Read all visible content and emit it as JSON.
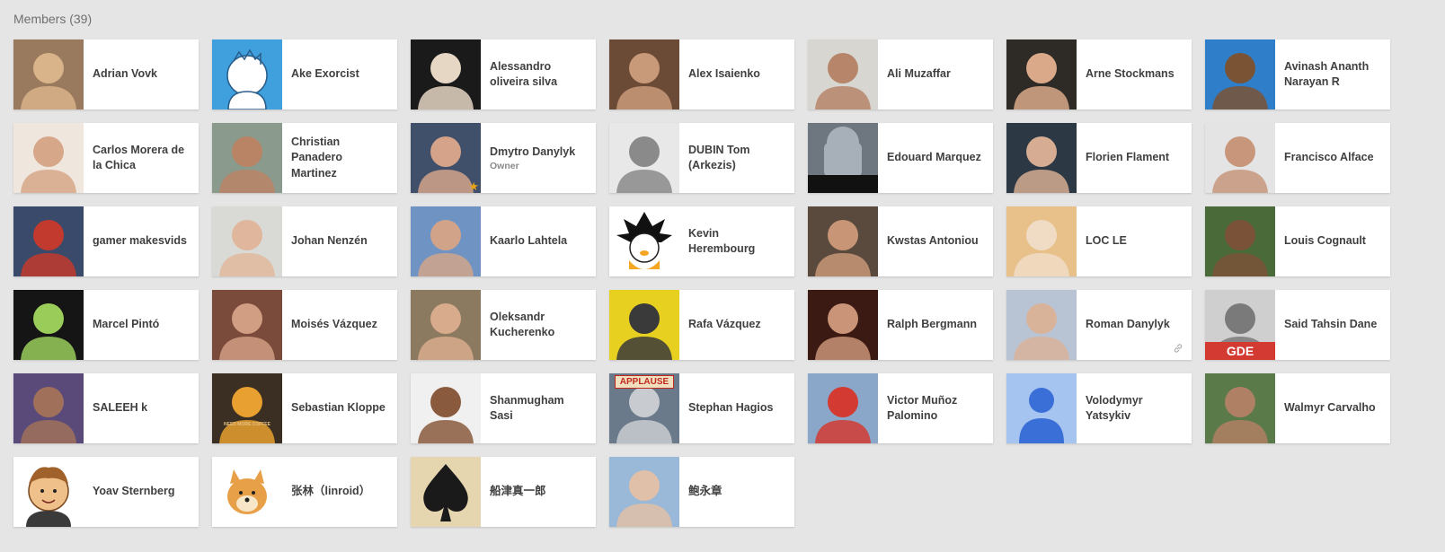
{
  "header": {
    "title": "Members (39)"
  },
  "colors": {
    "background": "#e5e5e5",
    "card": "#ffffff",
    "name_text": "#404040",
    "role_text": "#8a8a8a"
  },
  "members": [
    {
      "name": "Adrian Vovk",
      "slug": "adrian-vovk",
      "bg": "#9a7a5e",
      "fg": "#d9b38a"
    },
    {
      "name": "Ake Exorcist",
      "slug": "ake-exorcist",
      "bg": "#3fa0dd",
      "fg": "#ffffff",
      "cartoon": true
    },
    {
      "name": "Alessandro oliveira silva",
      "slug": "alessandro-oliveira-silva",
      "bg": "#1a1a1a",
      "fg": "#e6d6c4"
    },
    {
      "name": "Alex Isaienko",
      "slug": "alex-isaienko",
      "bg": "#6b4a36",
      "fg": "#c99a7a"
    },
    {
      "name": "Ali Muzaffar",
      "slug": "ali-muzaffar",
      "bg": "#d8d6d1",
      "fg": "#b7856a"
    },
    {
      "name": "Arne Stockmans",
      "slug": "arne-stockmans",
      "bg": "#2e2a26",
      "fg": "#d9a98a"
    },
    {
      "name": "Avinash Ananth Narayan R",
      "slug": "avinash-ananth-narayan-r",
      "bg": "#2f7ec9",
      "fg": "#7a5234"
    },
    {
      "name": "Carlos Morera de la Chica",
      "slug": "carlos-morera-de-la-chica",
      "bg": "#efe6de",
      "fg": "#d7a789"
    },
    {
      "name": "Christian Panadero Martinez",
      "slug": "christian-panadero-martinez",
      "bg": "#8a9a8c",
      "fg": "#b98466"
    },
    {
      "name": "Dmytro Danylyk",
      "slug": "dmytro-danylyk",
      "role": "Owner",
      "owner": true,
      "bg": "#40506a",
      "fg": "#d4a38a"
    },
    {
      "name": "DUBIN Tom (Arkezis)",
      "slug": "dubin-tom-arkezis",
      "bg": "#e8e8e8",
      "fg": "#8a8a8a",
      "mono": true
    },
    {
      "name": "Edouard Marquez",
      "slug": "edouard-marquez",
      "bg": "#6e7680",
      "fg": "#a7b0b8",
      "robot": true
    },
    {
      "name": "Florien Flament",
      "slug": "florien-flament",
      "bg": "#2d3845",
      "fg": "#d6ad92"
    },
    {
      "name": "Francisco Alface",
      "slug": "francisco-alface",
      "bg": "#e4e4e4",
      "fg": "#c7967b"
    },
    {
      "name": "gamer makesvids",
      "slug": "gamer-makesvids",
      "bg": "#3a4a6a",
      "fg": "#c23a2e"
    },
    {
      "name": "Johan Nenzén",
      "slug": "johan-nenzen",
      "bg": "#d9d9d5",
      "fg": "#e0b79c"
    },
    {
      "name": "Kaarlo Lahtela",
      "slug": "kaarlo-lahtela",
      "bg": "#6f93c2",
      "fg": "#d1a48a"
    },
    {
      "name": "Kevin Herembourg",
      "slug": "kevin-herembourg",
      "bg": "#ffffff",
      "fg": "#f5a623",
      "goku": true
    },
    {
      "name": "Kwstas Antoniou",
      "slug": "kwstas-antoniou",
      "bg": "#5a4a3e",
      "fg": "#c89677"
    },
    {
      "name": "LOC LE",
      "slug": "loc-le",
      "bg": "#e7c08a",
      "fg": "#f0dcc4"
    },
    {
      "name": "Louis Cognault",
      "slug": "louis-cognault",
      "bg": "#4b6a3a",
      "fg": "#7a5238"
    },
    {
      "name": "Marcel Pintó",
      "slug": "marcel-pinto",
      "bg": "#151515",
      "fg": "#9acc5a"
    },
    {
      "name": "Moisés Vázquez",
      "slug": "moises-vazquez",
      "bg": "#7a4a3a",
      "fg": "#d19e84"
    },
    {
      "name": "Oleksandr Kucherenko",
      "slug": "oleksandr-kucherenko",
      "bg": "#8c7a60",
      "fg": "#d8ab8c"
    },
    {
      "name": "Rafa Vázquez",
      "slug": "rafa-vazquez",
      "bg": "#e8d020",
      "fg": "#3a3a3a"
    },
    {
      "name": "Ralph Bergmann",
      "slug": "ralph-bergmann",
      "bg": "#3a1a12",
      "fg": "#c99478"
    },
    {
      "name": "Roman Danylyk",
      "slug": "roman-danylyk",
      "link": true,
      "bg": "#b8c4d4",
      "fg": "#d8b39a"
    },
    {
      "name": "Said Tahsin Dane",
      "slug": "said-tahsin-dane",
      "bg": "#cfcfcf",
      "fg": "#7a7a7a",
      "gde": true,
      "gde_label": "GDE"
    },
    {
      "name": "SALEEH k",
      "slug": "saleeh-k",
      "bg": "#5a4a7a",
      "fg": "#a0705a"
    },
    {
      "name": "Sebastian Kloppe",
      "slug": "sebastian-kloppe",
      "bg": "#3a2f22",
      "fg": "#e8a030",
      "coffee": true,
      "coffee_label": "NEED MORE COFFEE"
    },
    {
      "name": "Shanmugham Sasi",
      "slug": "shanmugham-sasi",
      "bg": "#f0f0f0",
      "fg": "#8a5a3e"
    },
    {
      "name": "Stephan Hagios",
      "slug": "stephan-hagios",
      "bg": "#6a7a8a",
      "fg": "#c8ccd0",
      "applause": true,
      "applause_label": "APPLAUSE"
    },
    {
      "name": "Victor Muñoz Palomino",
      "slug": "victor-munoz-palomino",
      "bg": "#8aa6c8",
      "fg": "#d23a32"
    },
    {
      "name": "Volodymyr Yatsykiv",
      "slug": "volodymyr-yatsykiv",
      "bg": "#a6c4f0",
      "fg": "#3b6fd8",
      "default_avatar": true
    },
    {
      "name": "Walmyr Carvalho",
      "slug": "walmyr-carvalho",
      "bg": "#5a7a4a",
      "fg": "#b08064"
    },
    {
      "name": "Yoav Sternberg",
      "slug": "yoav-sternberg",
      "bg": "#ffffff",
      "fg": "#f0c08a",
      "cartoon2": true
    },
    {
      "name": "张林（linroid）",
      "slug": "zhang-lin-linroid",
      "bg": "#ffffff",
      "fg": "#e8a048",
      "doge": true
    },
    {
      "name": "船津真一郎",
      "slug": "funatsu-shinichiro",
      "bg": "#e6d6b0",
      "fg": "#1a1a1a",
      "spade": true
    },
    {
      "name": "鲍永章",
      "slug": "bao-yongzhang",
      "bg": "#9ab8d8",
      "fg": "#e0c0a8"
    }
  ]
}
